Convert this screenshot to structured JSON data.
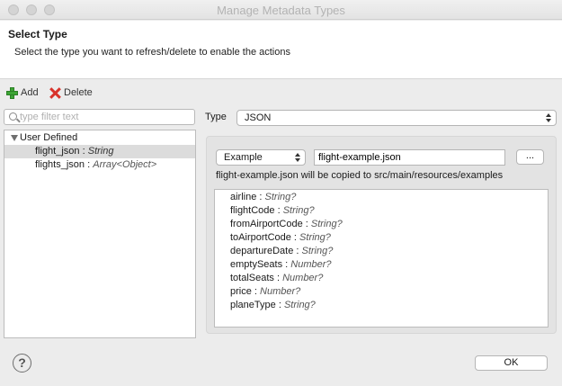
{
  "window": {
    "title": "Manage Metadata Types"
  },
  "header": {
    "title": "Select Type",
    "description": "Select the type you want to refresh/delete to enable the actions"
  },
  "toolbar": {
    "add_label": "Add",
    "delete_label": "Delete"
  },
  "filter": {
    "placeholder": "type filter text",
    "value": ""
  },
  "tree": {
    "group_label": "User Defined",
    "items": [
      {
        "name": "flight_json",
        "type": "String",
        "selected": true
      },
      {
        "name": "flights_json",
        "type": "Array<Object>",
        "selected": false
      }
    ]
  },
  "type_selector": {
    "label": "Type",
    "value": "JSON"
  },
  "example": {
    "mode_value": "Example",
    "file_value": "flight-example.json",
    "browse_label": "...",
    "hint": "flight-example.json will be copied to src/main/resources/examples"
  },
  "fields": [
    {
      "name": "airline",
      "type": "String?"
    },
    {
      "name": "flightCode",
      "type": "String?"
    },
    {
      "name": "fromAirportCode",
      "type": "String?"
    },
    {
      "name": "toAirportCode",
      "type": "String?"
    },
    {
      "name": "departureDate",
      "type": "String?"
    },
    {
      "name": "emptySeats",
      "type": "Number?"
    },
    {
      "name": "totalSeats",
      "type": "Number?"
    },
    {
      "name": "price",
      "type": "Number?"
    },
    {
      "name": "planeType",
      "type": "String?"
    }
  ],
  "footer": {
    "help_symbol": "?",
    "ok_label": "OK"
  }
}
